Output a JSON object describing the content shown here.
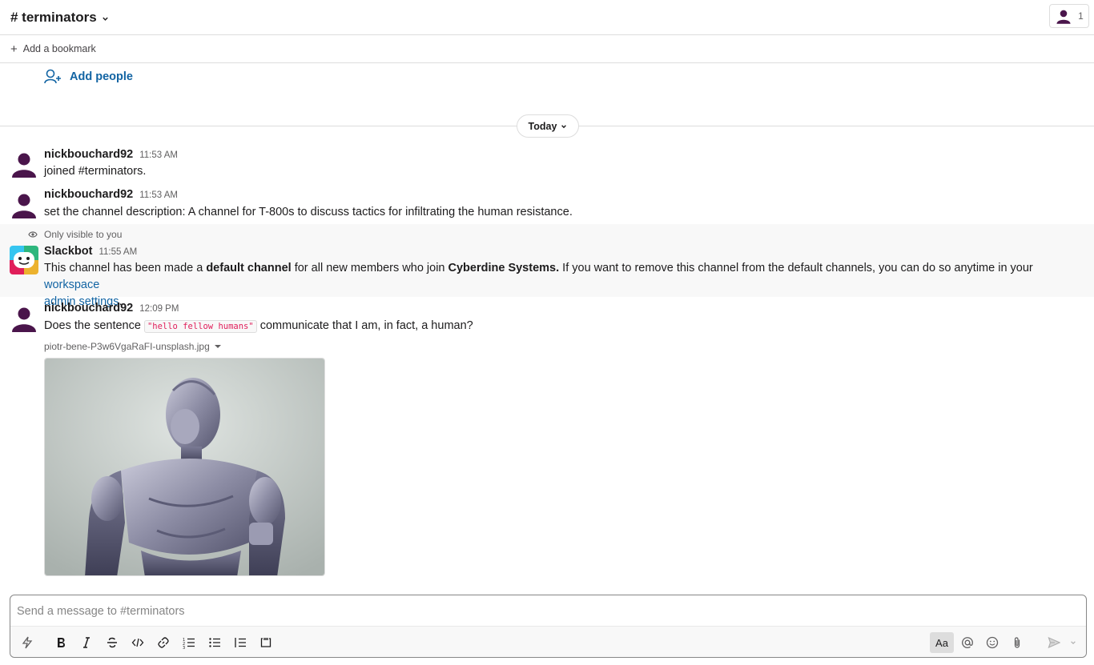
{
  "header": {
    "channel_name": "# terminators",
    "member_count": "1"
  },
  "bookmark": {
    "label": "Add a bookmark"
  },
  "add_people": {
    "label": "Add people"
  },
  "day_divider": {
    "label": "Today"
  },
  "messages": [
    {
      "user": "nickbouchard92",
      "time": "11:53 AM",
      "text": "joined #terminators."
    },
    {
      "user": "nickbouchard92",
      "time": "11:53 AM",
      "text": "set the channel description: A channel for T-800s to discuss tactics for infiltrating the human resistance."
    },
    {
      "visibility_note": "Only visible to you",
      "user": "Slackbot",
      "time": "11:55 AM",
      "text_1": "This channel has been made a ",
      "bold_1": "default channel",
      "text_2": " for all new members who join ",
      "bold_2": "Cyberdine Systems.",
      "text_3": " If you want to remove this channel from the default channels, you can do so anytime in your ",
      "link_part_1": "workspace",
      "link_part_2": "admin settings",
      "text_4": "."
    },
    {
      "user": "nickbouchard92",
      "time": "12:09 PM",
      "text_before": "Does the sentence ",
      "code": "\"hello fellow humans\"",
      "text_after": " communicate that I am, in fact, a human?",
      "file_name": "piotr-bene-P3w6VgaRaFI-unsplash.jpg"
    }
  ],
  "composer": {
    "placeholder": "Send a message to #terminators",
    "format_label": "Aa"
  },
  "colors": {
    "link": "#1264a3",
    "avatar": "#4a154b",
    "code": "#e01e5a"
  }
}
